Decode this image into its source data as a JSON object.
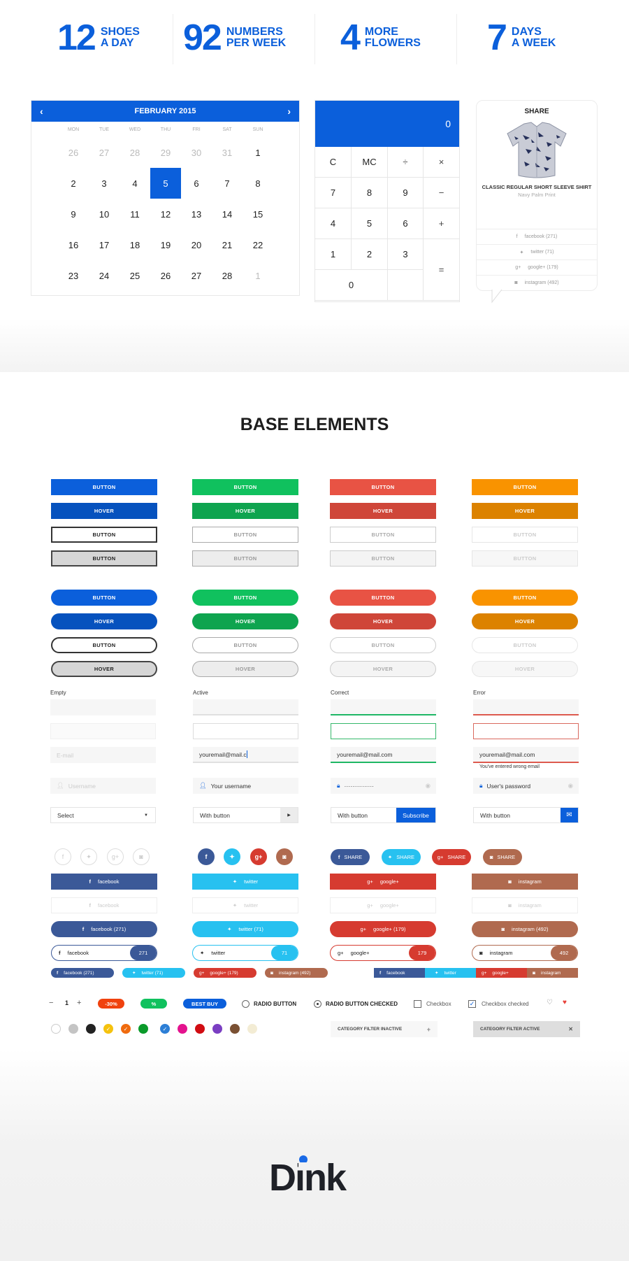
{
  "stats": [
    {
      "number": "12",
      "label1": "SHOES",
      "label2": "A DAY"
    },
    {
      "number": "92",
      "label1": "NUMBERS",
      "label2": "PER WEEK"
    },
    {
      "number": "4",
      "label1": "MORE",
      "label2": "FLOWERS"
    },
    {
      "number": "7",
      "label1": "DAYS",
      "label2": "A WEEK"
    }
  ],
  "calendar": {
    "title": "FEBRUARY 2015",
    "prev_icon": "‹",
    "next_icon": "›",
    "weekdays": [
      "MON",
      "TUE",
      "WED",
      "THU",
      "FRI",
      "SAT",
      "SUN"
    ],
    "days": [
      "26",
      "27",
      "28",
      "29",
      "30",
      "31",
      "1",
      "2",
      "3",
      "4",
      "5",
      "6",
      "7",
      "8",
      "9",
      "10",
      "11",
      "12",
      "13",
      "14",
      "15",
      "16",
      "17",
      "18",
      "19",
      "20",
      "21",
      "22",
      "23",
      "24",
      "25",
      "26",
      "27",
      "28",
      "1"
    ],
    "dim_indexes": [
      0,
      1,
      2,
      3,
      4,
      5,
      34
    ],
    "selected": "5"
  },
  "calculator": {
    "display": "0",
    "keys": [
      "C",
      "MC",
      "÷",
      "×",
      "7",
      "8",
      "9",
      "−",
      "4",
      "5",
      "6",
      "+",
      "1",
      "2",
      "3",
      "=",
      "0"
    ]
  },
  "share_card": {
    "title": "SHARE",
    "product_name": "CLASSIC REGULAR SHORT SLEEVE SHIRT",
    "product_sub": "Navy Palm Print",
    "items": [
      {
        "icon": "f",
        "label": "facebook (271)"
      },
      {
        "icon": "🐦",
        "label": "twitter (71)"
      },
      {
        "icon": "g+",
        "label": "google+ (179)"
      },
      {
        "icon": "◙",
        "label": "instagram (492)"
      }
    ]
  },
  "section_title": "BASE ELEMENTS",
  "colors": {
    "blue": "#0b5fdb",
    "blue_hover": "#0652be",
    "green": "#10c15e",
    "green_hover": "#0ea44f",
    "red": "#e85344",
    "red_hover": "#cf4639",
    "orange": "#f99300",
    "orange_hover": "#dc8200",
    "facebook": "#3b5998",
    "twitter": "#27c1f0",
    "google": "#d63b30",
    "instagram": "#b06a4f"
  },
  "buttons": {
    "button": "BUTTON",
    "hover": "HOVER"
  },
  "forms": {
    "labels": [
      "Empty",
      "Active",
      "Correct",
      "Error"
    ],
    "email_placeholder": "E-mail",
    "active_email": "youremail@mail.c",
    "email_value": "youremail@mail.com",
    "error_message": "You've entered wrong email",
    "username_placeholder": "Username",
    "username_value": "Your username",
    "password_masked": "···············",
    "password_placeholder": "User's password",
    "select_value": "Select",
    "with_button": "With button",
    "subscribe": "Subscribe"
  },
  "social": {
    "facebook": "facebook",
    "twitter": "twitter",
    "google": "google+",
    "instagram": "instagram",
    "facebook_count": "facebook (271)",
    "twitter_count": "twitter (71)",
    "google_count": "google+ (179)",
    "instagram_count": "instagram (492)",
    "fb_n": "271",
    "tw_n": "71",
    "gp_n": "179",
    "ig_n": "492",
    "share": "SHARE"
  },
  "misc": {
    "qty_minus": "−",
    "qty_value": "1",
    "qty_plus": "+",
    "badge_discount": "-30%",
    "badge_percent": "%",
    "badge_best": "BEST BUY",
    "radio": "RADIO BUTTON",
    "radio_checked": "RADIO BUTTON CHECKED",
    "checkbox": "Checkbox",
    "checkbox_checked": "Checkbox checked",
    "filter_inactive": "CATEGORY FILTER INACTIVE",
    "filter_active": "CATEGORY FILTER ACTIVE",
    "swatches": [
      "#ffffff",
      "#c4c4c4",
      "#222222",
      "#f5c20e",
      "#f06b0e",
      "#0a9a2a",
      "#2d7fd6",
      "#e4128e",
      "#d10c12",
      "#7a3ec2",
      "#7a5033",
      "#f3ecd4"
    ],
    "checked_swatches": [
      3,
      4,
      6
    ]
  },
  "brand": {
    "logo": "Dink",
    "dot_color": "#1a6ae6"
  }
}
